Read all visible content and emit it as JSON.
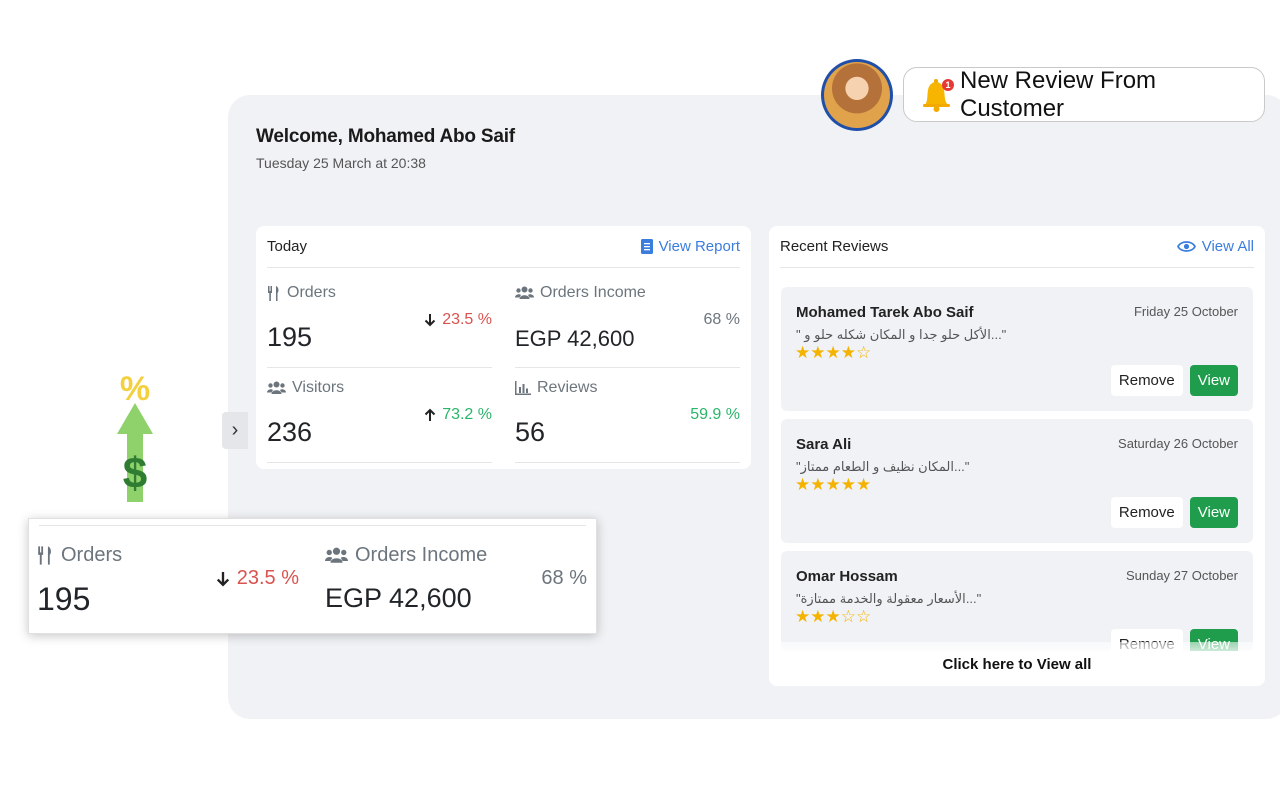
{
  "welcome": {
    "title": "Welcome, Mohamed Abo Saif",
    "datetime": "Tuesday 25 March at 20:38"
  },
  "notification": {
    "badge_count": "1",
    "text": "New Review From Customer",
    "icon": "bell-icon"
  },
  "today": {
    "title": "Today",
    "view_report_label": "View Report",
    "stats": {
      "orders": {
        "label": "Orders",
        "value": "195",
        "change": "23.5 %",
        "direction": "down",
        "icon": "utensils-icon"
      },
      "income": {
        "label": "Orders Income",
        "value": "EGP 42,600",
        "change": "68 %",
        "icon": "users-icon"
      },
      "visitors": {
        "label": "Visitors",
        "value": "236",
        "change": "73.2 %",
        "direction": "up",
        "icon": "users-icon"
      },
      "reviews": {
        "label": "Reviews",
        "value": "56",
        "change": "59.9 %",
        "icon": "bar-chart-icon"
      }
    }
  },
  "recent_reviews": {
    "title": "Recent Reviews",
    "view_all_label": "View All",
    "footer_label": "Click here to View all",
    "remove_label": "Remove",
    "view_label": "View",
    "items": [
      {
        "name": "Mohamed Tarek Abo Saif",
        "date": "Friday 25 October",
        "quote": "\" الأكل حلو جدا و المكان شكله حلو و...\"",
        "rating": 4,
        "stars": "★★★★☆"
      },
      {
        "name": "Sara Ali",
        "date": "Saturday 26 October",
        "quote": "\"المكان نظيف و الطعام ممتاز...\"",
        "rating": 5,
        "stars": "★★★★★"
      },
      {
        "name": "Omar Hossam",
        "date": "Sunday 27 October",
        "quote": "\"الأسعار معقولة والخدمة ممتازة...\"",
        "rating": 3,
        "stars": "★★★☆☆"
      }
    ]
  },
  "colors": {
    "accent": "#3b7ddd",
    "positive": "#2bb56a",
    "negative": "#d9534f",
    "view_button": "#1f9d4d",
    "star": "#f5b301"
  }
}
